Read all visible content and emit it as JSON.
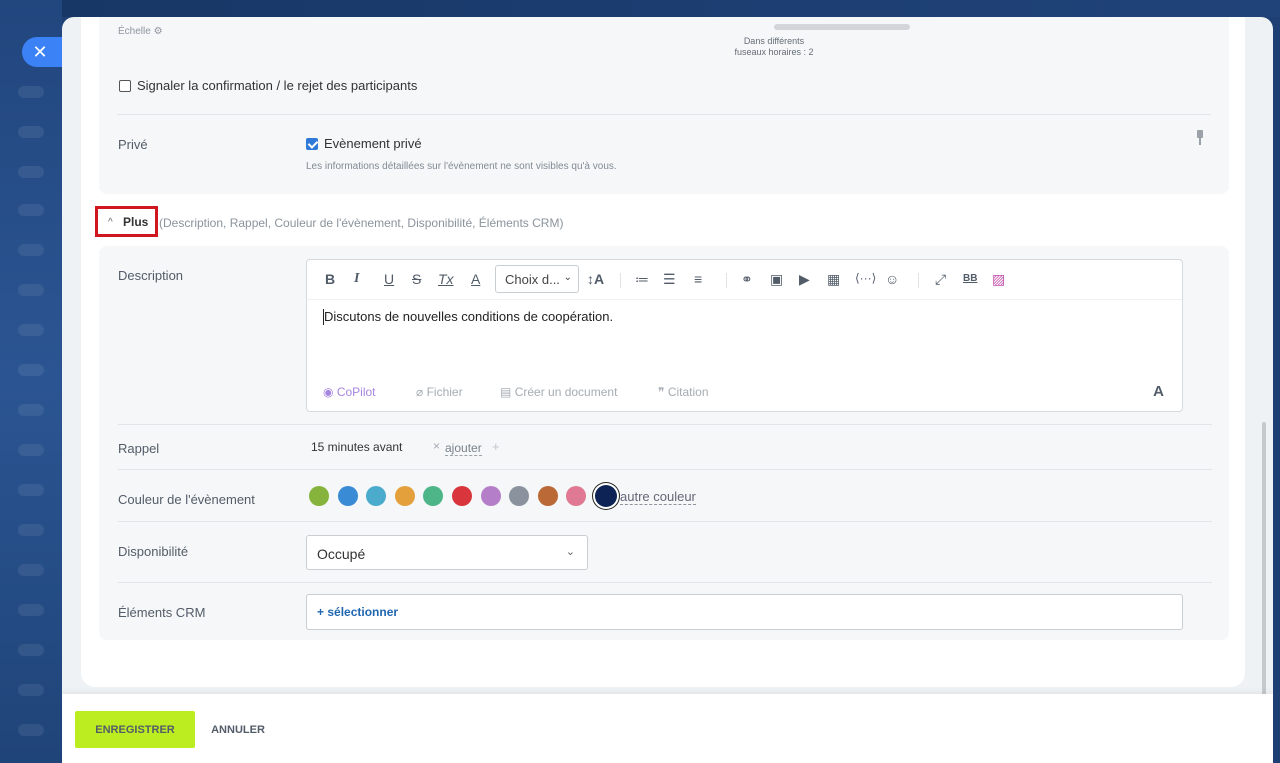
{
  "close": {
    "icon": "close-icon",
    "glyph": "✕"
  },
  "scale": {
    "label": "Échelle",
    "icon": "gear-icon",
    "glyph": "⚙"
  },
  "timezones": {
    "line1": "Dans différents",
    "line2": "fuseaux horaires : 2"
  },
  "notify": {
    "label": "Signaler la confirmation / le rejet des participants",
    "checked": false
  },
  "private": {
    "label": "Privé",
    "checkbox_label": "Evènement privé",
    "checked": true,
    "hint": "Les informations détaillées sur l'évènement ne sont visibles qu'à vous."
  },
  "more": {
    "label": "Plus",
    "chevron": "^",
    "sub": "(Description, Rappel, Couleur de l'évènement, Disponibilité, Éléments CRM)"
  },
  "description": {
    "label": "Description",
    "text": "Discutons de nouvelles conditions de coopération.",
    "toolbar": {
      "bold": "B",
      "italic": "I",
      "underline": "U",
      "strike": "S",
      "clear": "Tx",
      "color": "A",
      "font_select": "Choix d...",
      "font_select_chevron": "⌄",
      "font_size": "↕A",
      "ordered_list": "≔",
      "bullet_list": "☰",
      "align": "≡",
      "link": "⚭",
      "image": "▣",
      "video": "▶",
      "table": "▦",
      "code": "⟨···⟩",
      "emoji": "☺",
      "fullscreen": "⤢",
      "bbcode": "BB",
      "ai_image": "▨"
    },
    "tools": {
      "copilot": "CoPilot",
      "file": "Fichier",
      "create_doc": "Créer un document",
      "quote": "Citation",
      "font": "A"
    }
  },
  "reminder": {
    "label": "Rappel",
    "value": "15 minutes avant",
    "remove": "×",
    "add": "ajouter",
    "add_plus": "+"
  },
  "color": {
    "label": "Couleur de l'évènement",
    "swatches": [
      "#86b33b",
      "#3a8bd6",
      "#4aabcc",
      "#e4a03b",
      "#4db587",
      "#d8363c",
      "#b57ec8",
      "#8a929d",
      "#bb6937",
      "#e07a92",
      "#0d2355"
    ],
    "selected_index": 10,
    "other": "autre couleur"
  },
  "availability": {
    "label": "Disponibilité",
    "value": "Occupé",
    "chevron": "⌄"
  },
  "crm": {
    "label": "Éléments CRM",
    "action": "+  sélectionner"
  },
  "footer": {
    "save": "ENREGISTRER",
    "cancel": "ANNULER"
  }
}
